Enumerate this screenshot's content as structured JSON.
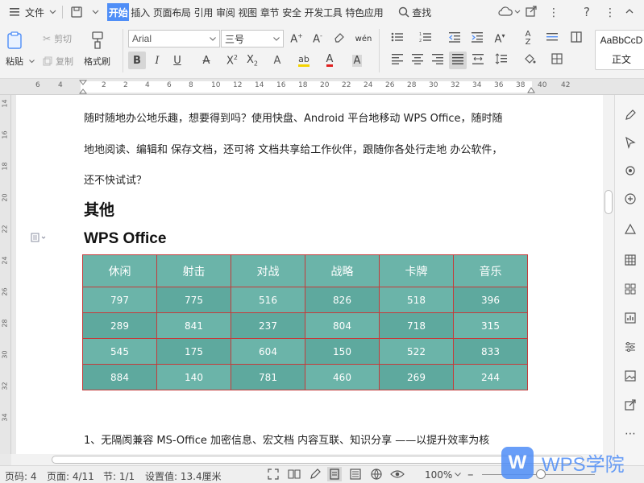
{
  "menubar": {
    "file_label": "文件",
    "tabs": [
      "开始",
      "插入",
      "页面布局",
      "引用",
      "审阅",
      "视图",
      "章节",
      "安全",
      "开发工具",
      "特色应用"
    ],
    "active_tab": "开始",
    "search_label": "查找"
  },
  "ribbon": {
    "paste_label": "粘贴",
    "cut_label": "剪切",
    "copy_label": "复制",
    "format_painter_label": "格式刷",
    "font_name": "Arial",
    "font_size": "三号",
    "style_preview": "AaBbCcD",
    "style_name": "正文"
  },
  "ruler": {
    "h_numbers": [
      "6",
      "4",
      "2",
      "2",
      "4",
      "6",
      "8",
      "10",
      "12",
      "14",
      "16",
      "18",
      "20",
      "22",
      "24",
      "26",
      "28",
      "30",
      "32",
      "34",
      "36",
      "38",
      "40",
      "42"
    ],
    "v_numbers": [
      "14",
      "16",
      "18",
      "20",
      "22",
      "24",
      "26",
      "28",
      "30",
      "32",
      "34"
    ]
  },
  "document": {
    "para1": "随时随地办公地乐趣，想要得到吗？使用快盘、Android 平台地移动 WPS Office，随时随",
    "para2": "地地阅读、编辑和  保存文档，还可将  文档共享给工作伙伴，跟随你各处行走地  办公软件，",
    "para3": "还不快试试？",
    "heading_other": "其他",
    "heading_wps": "WPS Office",
    "table": {
      "headers": [
        "休闲",
        "射击",
        "对战",
        "战略",
        "卡牌",
        "音乐"
      ],
      "rows": [
        [
          "797",
          "775",
          "516",
          "826",
          "518",
          "396"
        ],
        [
          "289",
          "841",
          "237",
          "804",
          "718",
          "315"
        ],
        [
          "545",
          "175",
          "604",
          "150",
          "522",
          "833"
        ],
        [
          "884",
          "140",
          "781",
          "460",
          "269",
          "244"
        ]
      ]
    },
    "para_bottom": "1、无隔阂兼容  MS-Office 加密信息、宏文档  内容互联、知识分享  ——以提升效率为核"
  },
  "statusbar": {
    "page_num": "页码: 4",
    "page_count": "页面: 4/11",
    "section": "节: 1/1",
    "setting": "设置值: 13.4厘米",
    "zoom": "100%"
  },
  "watermark": {
    "logo_letter": "W",
    "text": "WPS学院"
  },
  "colors": {
    "accent": "#4f8ef7",
    "table_fill": "#6bb4a9",
    "table_border": "#c43b3b"
  }
}
